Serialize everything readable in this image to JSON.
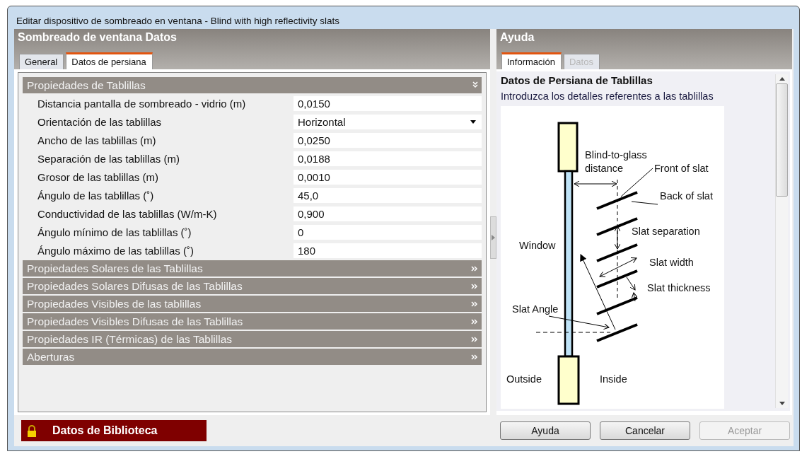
{
  "window": {
    "title": "Editar dispositivo de sombreado en ventana - Blind with high reflectivity slats"
  },
  "left_panel": {
    "title": "Sombreado de ventana Datos",
    "tabs": [
      {
        "label": "General",
        "selected": false
      },
      {
        "label": "Datos de persiana",
        "selected": true
      }
    ],
    "sections": [
      {
        "title": "Propiedades de Tablillas",
        "expanded": true,
        "rows": [
          {
            "label": "Distancia pantalla de sombreado - vidrio (m)",
            "value": "0,0150",
            "kind": "text"
          },
          {
            "label": "Orientación de las tablillas",
            "value": "Horizontal",
            "kind": "dropdown"
          },
          {
            "label": "Ancho de las tablillas (m)",
            "value": "0,0250",
            "kind": "text"
          },
          {
            "label": "Separación de las tablillas (m)",
            "value": "0,0188",
            "kind": "text"
          },
          {
            "label": "Grosor de las tablillas (m)",
            "value": "0,0010",
            "kind": "text"
          },
          {
            "label": "Ángulo de las tablillas (˚)",
            "value": "45,0",
            "kind": "text"
          },
          {
            "label": "Conductividad de las tablillas (W/m-K)",
            "value": "0,900",
            "kind": "text"
          },
          {
            "label": "Ángulo mínimo de las tablillas (˚)",
            "value": "0",
            "kind": "text"
          },
          {
            "label": "Ángulo máximo de las tablillas (˚)",
            "value": "180",
            "kind": "text"
          }
        ]
      },
      {
        "title": "Propiedades Solares de las Tablillas",
        "expanded": false
      },
      {
        "title": "Propiedades Solares Difusas de las Tablillas",
        "expanded": false
      },
      {
        "title": "Propiedades Visibles de las tablillas",
        "expanded": false
      },
      {
        "title": "Propiedades Visibles Difusas de las Tablillas",
        "expanded": false
      },
      {
        "title": "Propiedades IR (Térmicas) de las Tablillas",
        "expanded": false
      },
      {
        "title": "Aberturas",
        "expanded": false
      }
    ],
    "library_badge": "Datos de Biblioteca"
  },
  "right_panel": {
    "title": "Ayuda",
    "tabs": [
      {
        "label": "Información",
        "selected": true,
        "disabled": false
      },
      {
        "label": "Datos",
        "selected": false,
        "disabled": true
      }
    ],
    "heading": "Datos de Persiana de Tablillas",
    "text": "Introduzca los detalles referentes a las tablillas",
    "diagram_labels": [
      {
        "lines": [
          "Blind-to-glass",
          "distance"
        ]
      },
      {
        "lines": [
          "Front of slat"
        ]
      },
      {
        "lines": [
          "Back of slat"
        ]
      },
      {
        "lines": [
          "Slat separation"
        ]
      },
      {
        "lines": [
          "Window"
        ]
      },
      {
        "lines": [
          "Slat width"
        ]
      },
      {
        "lines": [
          "Slat thickness"
        ]
      },
      {
        "lines": [
          "Slat Angle"
        ]
      },
      {
        "lines": [
          "Outside"
        ]
      },
      {
        "lines": [
          "Inside"
        ]
      }
    ]
  },
  "buttons": [
    {
      "label": "Ayuda",
      "disabled": false
    },
    {
      "label": "Cancelar",
      "disabled": false
    },
    {
      "label": "Aceptar",
      "disabled": true
    }
  ]
}
